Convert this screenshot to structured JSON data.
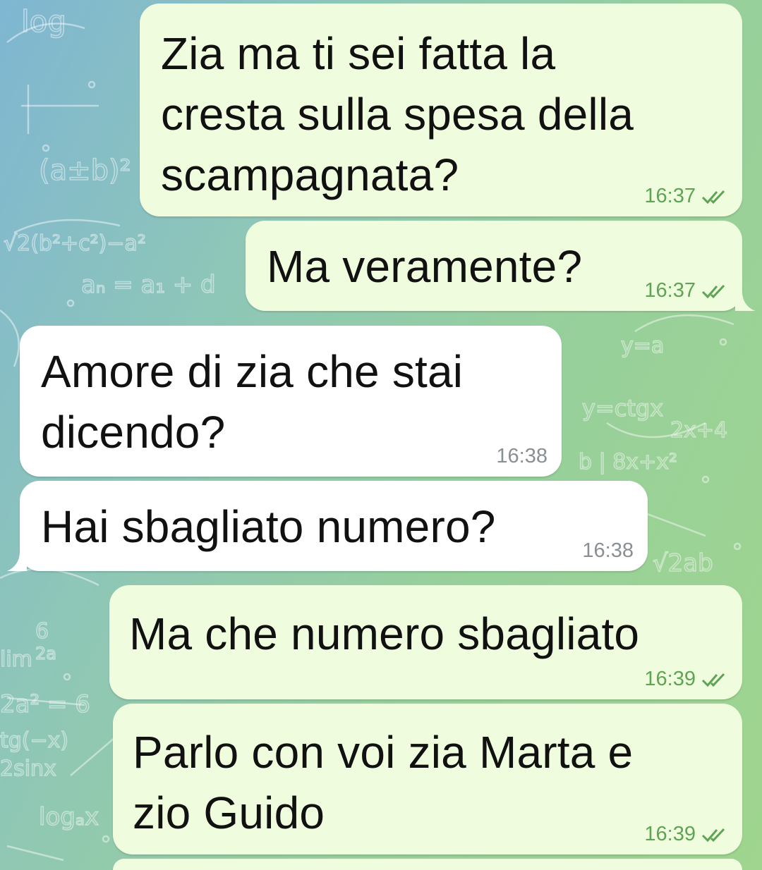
{
  "colors": {
    "outgoing_bubble": "#effdde",
    "incoming_bubble": "#ffffff",
    "outgoing_time": "#5ea454",
    "incoming_time": "#8a8f93",
    "read_check": "#5ea454"
  },
  "messages": [
    {
      "direction": "outgoing",
      "text": "Zia ma ti sei fatta la\ncresta sulla spesa della\nscampagnata?",
      "time": "16:37",
      "status": "read",
      "status_icon": "double-check-icon"
    },
    {
      "direction": "outgoing",
      "text": "Ma veramente?",
      "time": "16:37",
      "status": "read",
      "status_icon": "double-check-icon"
    },
    {
      "direction": "incoming",
      "text": "Amore di zia che stai\ndicendo?",
      "time": "16:38"
    },
    {
      "direction": "incoming",
      "text": "Hai sbagliato numero?",
      "time": "16:38"
    },
    {
      "direction": "outgoing",
      "text": "Ma che numero sbagliato",
      "time": "16:39",
      "status": "read",
      "status_icon": "double-check-icon"
    },
    {
      "direction": "outgoing",
      "text": "Parlo con voi zia Marta e\nzio Guido",
      "time": "16:39",
      "status": "read",
      "status_icon": "double-check-icon"
    }
  ]
}
